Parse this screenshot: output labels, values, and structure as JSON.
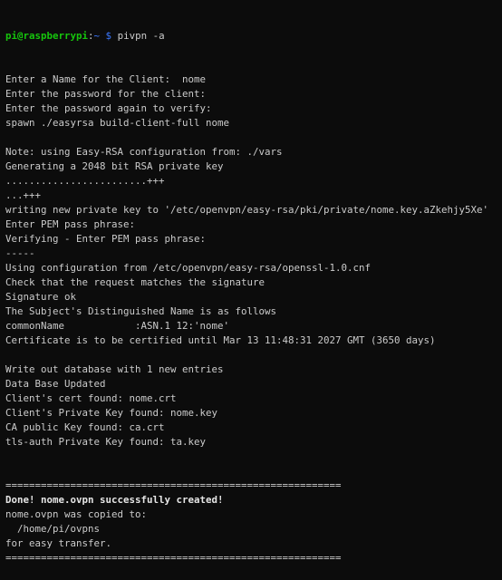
{
  "prompt": {
    "user_host": "pi@raspberrypi",
    "sep": ":",
    "path": "~",
    "symbol": " $ ",
    "command": "pivpn -a"
  },
  "colors": {
    "background": "#0c0c0c",
    "text": "#cccccc",
    "prompt_user": "#16c60c",
    "prompt_path": "#3b78ff"
  },
  "lines": [
    "Enter a Name for the Client:  nome",
    "Enter the password for the client:",
    "Enter the password again to verify:",
    "spawn ./easyrsa build-client-full nome",
    "",
    "Note: using Easy-RSA configuration from: ./vars",
    "Generating a 2048 bit RSA private key",
    "........................+++",
    "...+++",
    "writing new private key to '/etc/openvpn/easy-rsa/pki/private/nome.key.aZkehjy5Xe'",
    "Enter PEM pass phrase:",
    "Verifying - Enter PEM pass phrase:",
    "-----",
    "Using configuration from /etc/openvpn/easy-rsa/openssl-1.0.cnf",
    "Check that the request matches the signature",
    "Signature ok",
    "The Subject's Distinguished Name is as follows",
    "commonName            :ASN.1 12:'nome'",
    "Certificate is to be certified until Mar 13 11:48:31 2027 GMT (3650 days)",
    "",
    "Write out database with 1 new entries",
    "Data Base Updated",
    "Client's cert found: nome.crt",
    "Client's Private Key found: nome.key",
    "CA public Key found: ca.crt",
    "tls-auth Private Key found: ta.key",
    "",
    "",
    "=========================================================",
    "Done! nome.ovpn successfully created!",
    "nome.ovpn was copied to:",
    "  /home/pi/ovpns",
    "for easy transfer.",
    "========================================================="
  ]
}
